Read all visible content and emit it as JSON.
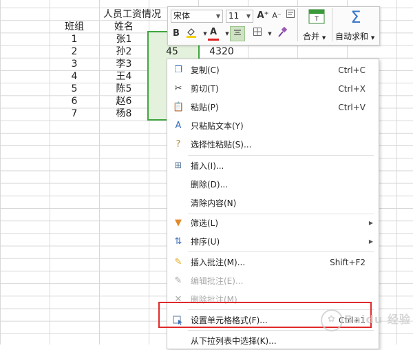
{
  "sheet": {
    "title": "人员工资情况",
    "headers": {
      "group": "班组",
      "name": "姓名"
    },
    "rows": [
      {
        "group": "1",
        "name": "张1"
      },
      {
        "group": "2",
        "name": "孙2"
      },
      {
        "group": "3",
        "name": "李3"
      },
      {
        "group": "4",
        "name": "王4"
      },
      {
        "group": "5",
        "name": "陈5"
      },
      {
        "group": "6",
        "name": "赵6"
      },
      {
        "group": "7",
        "name": "杨8"
      }
    ],
    "selected_value": "45",
    "adjacent_value": "4320"
  },
  "toolbar": {
    "font_name": "宋体",
    "font_size": "11",
    "grow_font": "A⁺",
    "shrink_font": "A⁻",
    "bold": "B",
    "font_color_letter": "A",
    "merge_label": "合并",
    "autosum_label": "自动求和",
    "sigma": "Σ",
    "font_color": "#e02020",
    "fill_color": "#f5d000"
  },
  "menu": {
    "copy": {
      "label": "复制(C)",
      "shortcut": "Ctrl+C"
    },
    "cut": {
      "label": "剪切(T)",
      "shortcut": "Ctrl+X"
    },
    "paste": {
      "label": "粘贴(P)",
      "shortcut": "Ctrl+V"
    },
    "paste_text": {
      "label": "只粘贴文本(Y)"
    },
    "paste_special": {
      "label": "选择性粘贴(S)..."
    },
    "insert": {
      "label": "插入(I)..."
    },
    "delete": {
      "label": "删除(D)..."
    },
    "clear": {
      "label": "清除内容(N)"
    },
    "filter": {
      "label": "筛选(L)"
    },
    "sort": {
      "label": "排序(U)"
    },
    "insert_comment": {
      "label": "插入批注(M)...",
      "shortcut": "Shift+F2"
    },
    "edit_comment": {
      "label": "编辑批注(E)..."
    },
    "delete_comment": {
      "label": "删除批注(M)"
    },
    "format_cells": {
      "label": "设置单元格格式(F)...",
      "shortcut": "Ctrl+1"
    },
    "pick_from_list": {
      "label": "从下拉列表中选择(K)..."
    }
  },
  "watermark": "Baidu 经验"
}
